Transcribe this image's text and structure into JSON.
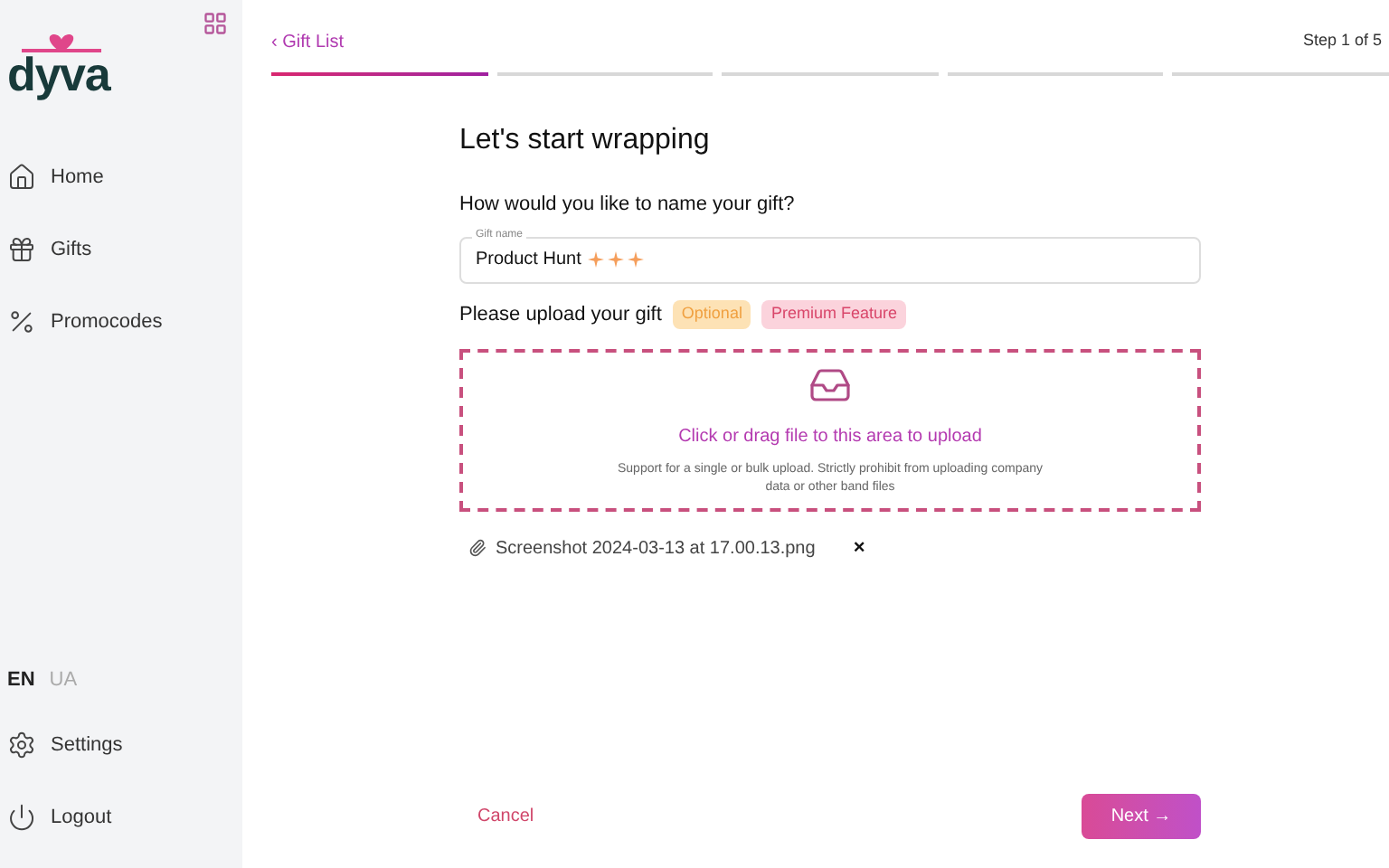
{
  "sidebar": {
    "logo": "dyva",
    "nav": [
      {
        "kind": "home",
        "label": "Home"
      },
      {
        "kind": "gift",
        "label": "Gifts"
      },
      {
        "kind": "percent",
        "label": "Promocodes"
      }
    ],
    "languages": [
      {
        "label": "EN",
        "selected": true
      },
      {
        "label": "UA",
        "selected": false
      }
    ],
    "bottom": [
      {
        "kind": "settings",
        "label": "Settings"
      },
      {
        "kind": "logout",
        "label": "Logout"
      }
    ]
  },
  "header": {
    "back": "‹ Gift List",
    "step": "Step 1 of 5",
    "steps": [
      {
        "done": true
      },
      {
        "done": false
      },
      {
        "done": false
      },
      {
        "done": false
      },
      {
        "done": false
      }
    ]
  },
  "form": {
    "title": "Let's start wrapping",
    "name_question": "How would you like to name your gift?",
    "name_field": {
      "label": "Gift name",
      "value": "Product Hunt"
    },
    "upload_label": "Please upload your gift",
    "badges": [
      {
        "kind": "optional",
        "label": "Optional"
      },
      {
        "kind": "premium",
        "label": "Premium Feature"
      }
    ],
    "dropzone": {
      "title": "Click or drag file to this area to upload",
      "hint": "Support for a single or bulk upload. Strictly prohibit from uploading company data or other band files"
    },
    "files": [
      {
        "name": "Screenshot 2024-03-13 at 17.00.13.png",
        "remove": "×"
      }
    ]
  },
  "footer": {
    "cancel": "Cancel",
    "next": "Next →"
  }
}
